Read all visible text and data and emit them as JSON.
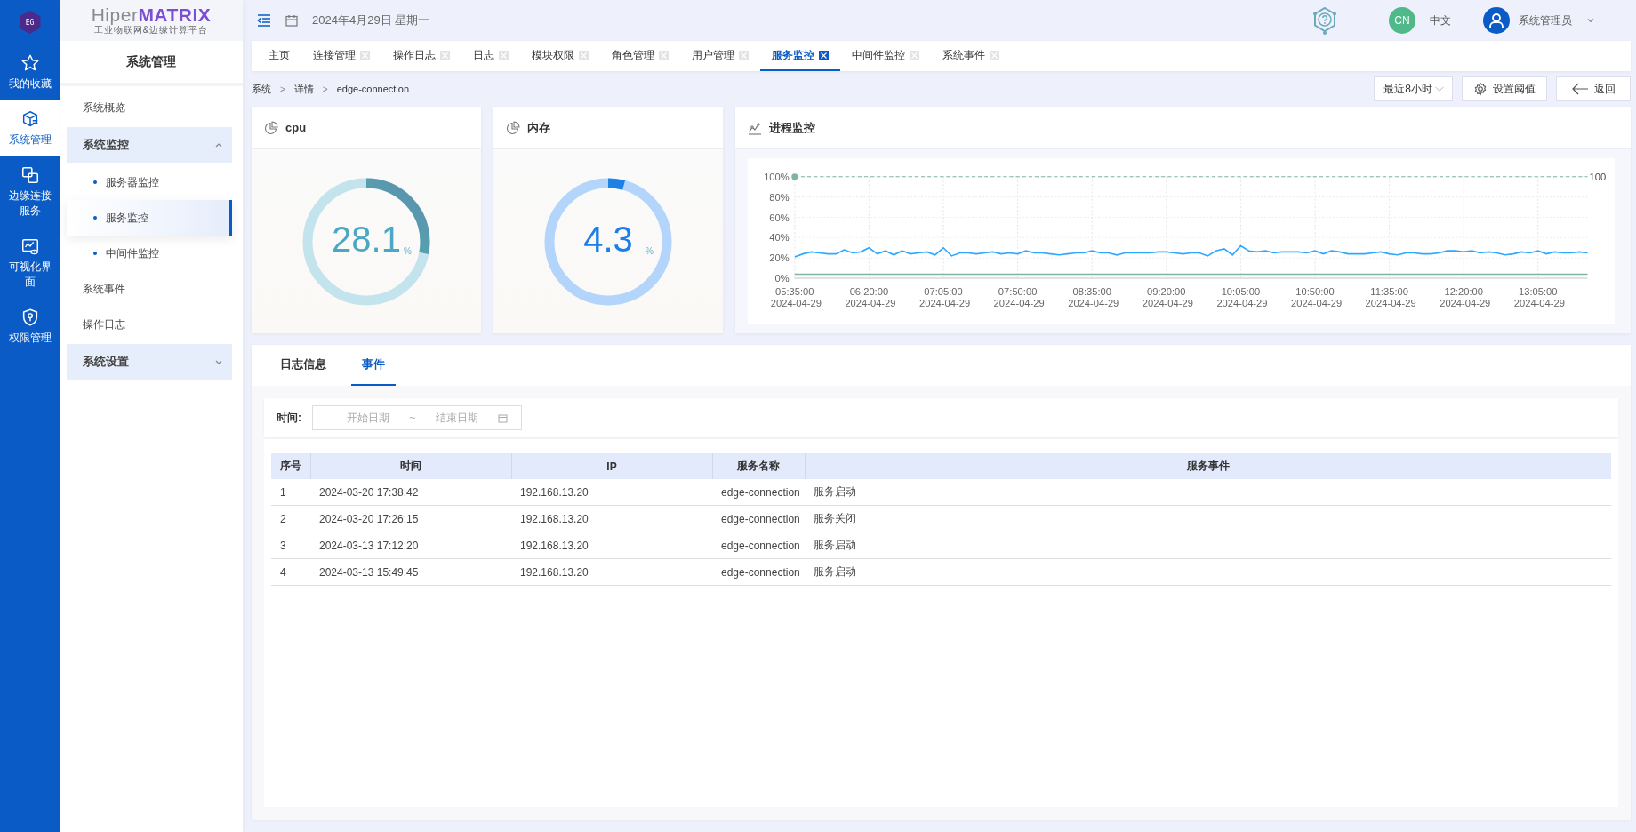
{
  "rail": {
    "logo": "EG",
    "items": [
      {
        "label": "我的收藏",
        "selected": false
      },
      {
        "label": "系统管理",
        "selected": true
      },
      {
        "label": "边缘连接服务",
        "selected": false
      },
      {
        "label": "可视化界面",
        "selected": false
      },
      {
        "label": "权限管理",
        "selected": false
      }
    ]
  },
  "brand": {
    "name_light": "Hiper",
    "name_bold": "MATRIX",
    "tagline": "工业物联网&边缘计算平台"
  },
  "sidebar": {
    "title": "系统管理",
    "items": [
      {
        "label": "系统概览",
        "kind": "item",
        "selected": false
      },
      {
        "label": "系统监控",
        "kind": "group",
        "expanded": true,
        "children": [
          {
            "label": "服务器监控",
            "kind": "subitem",
            "selected": false
          },
          {
            "label": "服务监控",
            "kind": "subitem",
            "selected": true
          },
          {
            "label": "中间件监控",
            "kind": "subitem",
            "selected": false
          }
        ]
      },
      {
        "label": "系统事件",
        "kind": "item",
        "selected": false
      },
      {
        "label": "操作日志",
        "kind": "item",
        "selected": false
      },
      {
        "label": "系统设置",
        "kind": "group",
        "expanded": false
      }
    ]
  },
  "header": {
    "date": "2024年4月29日 星期一",
    "language_badge": "CN",
    "language": "中文",
    "user": "系统管理员"
  },
  "tabs": [
    {
      "label": "主页",
      "selected": false,
      "closable": false
    },
    {
      "label": "连接管理",
      "selected": false,
      "closable": true
    },
    {
      "label": "操作日志",
      "selected": false,
      "closable": true
    },
    {
      "label": "日志",
      "selected": false,
      "closable": true
    },
    {
      "label": "模块权限",
      "selected": false,
      "closable": true
    },
    {
      "label": "角色管理",
      "selected": false,
      "closable": true
    },
    {
      "label": "用户管理",
      "selected": false,
      "closable": true
    },
    {
      "label": "服务监控",
      "selected": true,
      "closable": true
    },
    {
      "label": "中间件监控",
      "selected": false,
      "closable": true
    },
    {
      "label": "系统事件",
      "selected": false,
      "closable": true
    }
  ],
  "breadcrumb": {
    "separator": ">",
    "items": [
      "系统",
      "详情",
      "edge-connection"
    ]
  },
  "toolbar": {
    "range": "最近8小时",
    "threshold_button": "设置阈值",
    "back_button": "返回"
  },
  "gauges": [
    {
      "title": "cpu",
      "kind": "cpu",
      "value": "28.1",
      "unit": "%",
      "level": 0.281
    },
    {
      "title": "内存",
      "kind": "memory",
      "value": "4.3",
      "unit": "%",
      "level": 0.043
    }
  ],
  "process": {
    "title": "进程监控",
    "chart_data": {
      "type": "line",
      "categories": [
        "05:35:00 2024-04-29",
        null,
        null,
        null,
        null,
        null,
        null,
        null,
        null,
        "06:20:00 2024-04-29",
        null,
        null,
        null,
        null,
        null,
        null,
        null,
        null,
        "07:05:00 2024-04-29",
        null,
        null,
        null,
        null,
        null,
        null,
        null,
        null,
        "07:50:00 2024-04-29",
        null,
        null,
        null,
        null,
        null,
        null,
        null,
        null,
        "08:35:00 2024-04-29",
        null,
        null,
        null,
        null,
        null,
        null,
        null,
        null,
        "09:20:00 2024-04-29",
        null,
        null,
        null,
        null,
        null,
        null,
        null,
        null,
        "10:05:00 2024-04-29",
        null,
        null,
        null,
        null,
        null,
        null,
        null,
        null,
        "10:50:00 2024-04-29",
        null,
        null,
        null,
        null,
        null,
        null,
        null,
        null,
        "11:35:00 2024-04-29",
        null,
        null,
        null,
        null,
        null,
        null,
        null,
        null,
        "12:20:00 2024-04-29",
        null,
        null,
        null,
        null,
        null,
        null,
        null,
        null,
        "13:05:00 2024-04-29",
        null,
        null,
        null,
        null,
        null,
        null
      ],
      "series": [
        {
          "color": "#2ea7ff",
          "values": [
            21,
            24,
            26,
            25,
            24,
            24,
            28,
            25,
            26,
            30,
            24,
            27,
            23,
            27,
            24,
            25,
            26,
            23,
            30,
            22,
            25,
            25,
            24,
            25,
            26,
            24,
            25,
            24,
            27,
            25,
            25,
            24,
            23,
            24,
            25,
            25,
            27,
            25,
            25,
            23,
            25,
            25,
            25,
            25,
            26,
            26,
            25,
            24,
            25,
            25,
            22,
            27,
            29,
            23,
            32,
            27,
            26,
            27,
            25,
            26,
            26,
            26,
            25,
            27,
            24,
            27,
            26,
            24,
            24,
            24,
            25,
            26,
            24,
            23,
            25,
            25,
            24,
            24,
            25,
            27,
            27,
            26,
            27,
            25,
            26,
            25,
            23,
            24,
            26,
            25,
            27,
            24,
            26,
            25,
            25,
            26,
            25
          ]
        },
        {
          "color": "#7fb59f",
          "values": [
            4,
            4,
            4,
            4,
            4,
            4,
            4,
            4,
            4,
            4,
            4,
            4,
            4,
            4,
            4,
            4,
            4,
            4,
            4,
            4,
            4,
            4,
            4,
            4,
            4,
            4,
            4,
            4,
            4,
            4,
            4,
            4,
            4,
            4,
            4,
            4,
            4,
            4,
            4,
            4,
            4,
            4,
            4,
            4,
            4,
            4,
            4,
            4,
            4,
            4,
            4,
            4,
            4,
            4,
            4,
            4,
            4,
            4,
            4,
            4,
            4,
            4,
            4,
            4,
            4,
            4,
            4,
            4,
            4,
            4,
            4,
            4,
            4,
            4,
            4,
            4,
            4,
            4,
            4,
            4,
            4,
            4,
            4,
            4,
            4,
            4,
            4,
            4,
            4,
            4,
            4,
            4,
            4,
            4,
            4,
            4,
            4
          ]
        }
      ],
      "ylim": [
        0,
        100
      ],
      "yticks": [
        {
          "value": 0,
          "label": "0%"
        },
        {
          "value": 20,
          "label": "20%"
        },
        {
          "value": 40,
          "label": "40%"
        },
        {
          "value": 60,
          "label": "60%"
        },
        {
          "value": 80,
          "label": "80%"
        },
        {
          "value": 100,
          "label": "100%"
        }
      ],
      "grid": true,
      "ref_lines": [
        {
          "axis": "y",
          "value": 100,
          "label": "100"
        }
      ]
    }
  },
  "events": {
    "tabs": [
      {
        "label": "日志信息",
        "selected": false
      },
      {
        "label": "事件",
        "selected": true
      }
    ],
    "filter": {
      "label": "时间:",
      "start_placeholder": "开始日期",
      "separator": "~",
      "end_placeholder": "结束日期"
    },
    "table": {
      "columns": [
        "序号",
        "时间",
        "IP",
        "服务名称",
        "服务事件"
      ],
      "rows": [
        [
          "1",
          "2024-03-20 17:38:42",
          "192.168.13.20",
          "edge-connection",
          "服务启动"
        ],
        [
          "2",
          "2024-03-20 17:26:15",
          "192.168.13.20",
          "edge-connection",
          "服务关闭"
        ],
        [
          "3",
          "2024-03-13 17:12:20",
          "192.168.13.20",
          "edge-connection",
          "服务启动"
        ],
        [
          "4",
          "2024-03-13 15:49:45",
          "192.168.13.20",
          "edge-connection",
          "服务启动"
        ]
      ]
    }
  }
}
